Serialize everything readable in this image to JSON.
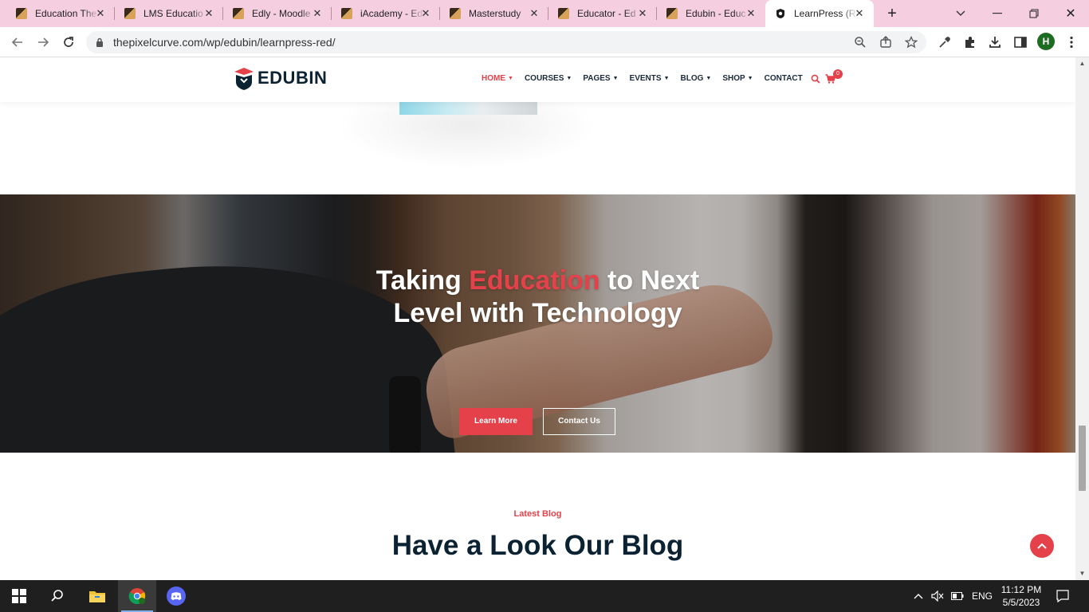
{
  "browser": {
    "tabs": [
      {
        "title": "Education The"
      },
      {
        "title": "LMS Educatio"
      },
      {
        "title": "Edly - Moodle"
      },
      {
        "title": "iAcademy - Ed"
      },
      {
        "title": "Masterstudy"
      },
      {
        "title": "Educator - Ed"
      },
      {
        "title": "Edubin - Educ"
      },
      {
        "title": "LearnPress (R"
      }
    ],
    "url": "thepixelcurve.com/wp/edubin/learnpress-red/",
    "profile_initial": "H"
  },
  "site": {
    "logo_text": "EDUBIN",
    "menu": [
      "HOME",
      "COURSES",
      "PAGES",
      "EVENTS",
      "BLOG",
      "SHOP",
      "CONTACT"
    ],
    "cart_count": "0"
  },
  "hero": {
    "title_pre": "Taking ",
    "title_highlight": "Education",
    "title_post_line1": " to Next",
    "title_line2": "Level with Technology",
    "learn_more": "Learn More",
    "contact_us": "Contact Us"
  },
  "blog": {
    "kicker": "Latest Blog",
    "title": "Have a Look Our Blog"
  },
  "taskbar": {
    "language": "ENG",
    "time": "11:12 PM",
    "date": "5/5/2023"
  },
  "colors": {
    "accent": "#e5414a",
    "navy": "#0b2233",
    "tabstrip": "#f5cfe0",
    "taskbar": "#1f1f1f"
  }
}
